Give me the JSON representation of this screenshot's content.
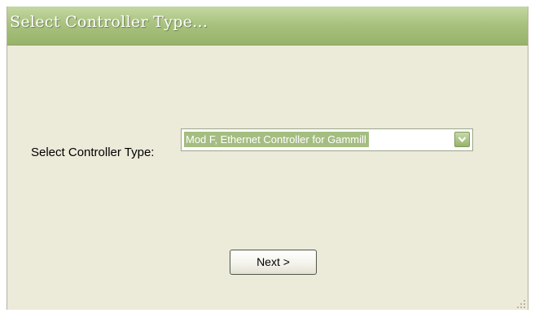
{
  "dialog": {
    "title": "Select Controller Type...",
    "controller_label": "Select Controller Type:",
    "controller_select": {
      "selected": "Mod F, Ethernet Controller for Gammill"
    },
    "next_button_label": "Next >"
  },
  "icons": {
    "dropdown": "chevron-down-icon",
    "resize": "resize-grip-icon"
  },
  "colors": {
    "title_bar": "#a9c27f",
    "dialog_background": "#ecead9",
    "selection_highlight": "#a4bd80"
  }
}
